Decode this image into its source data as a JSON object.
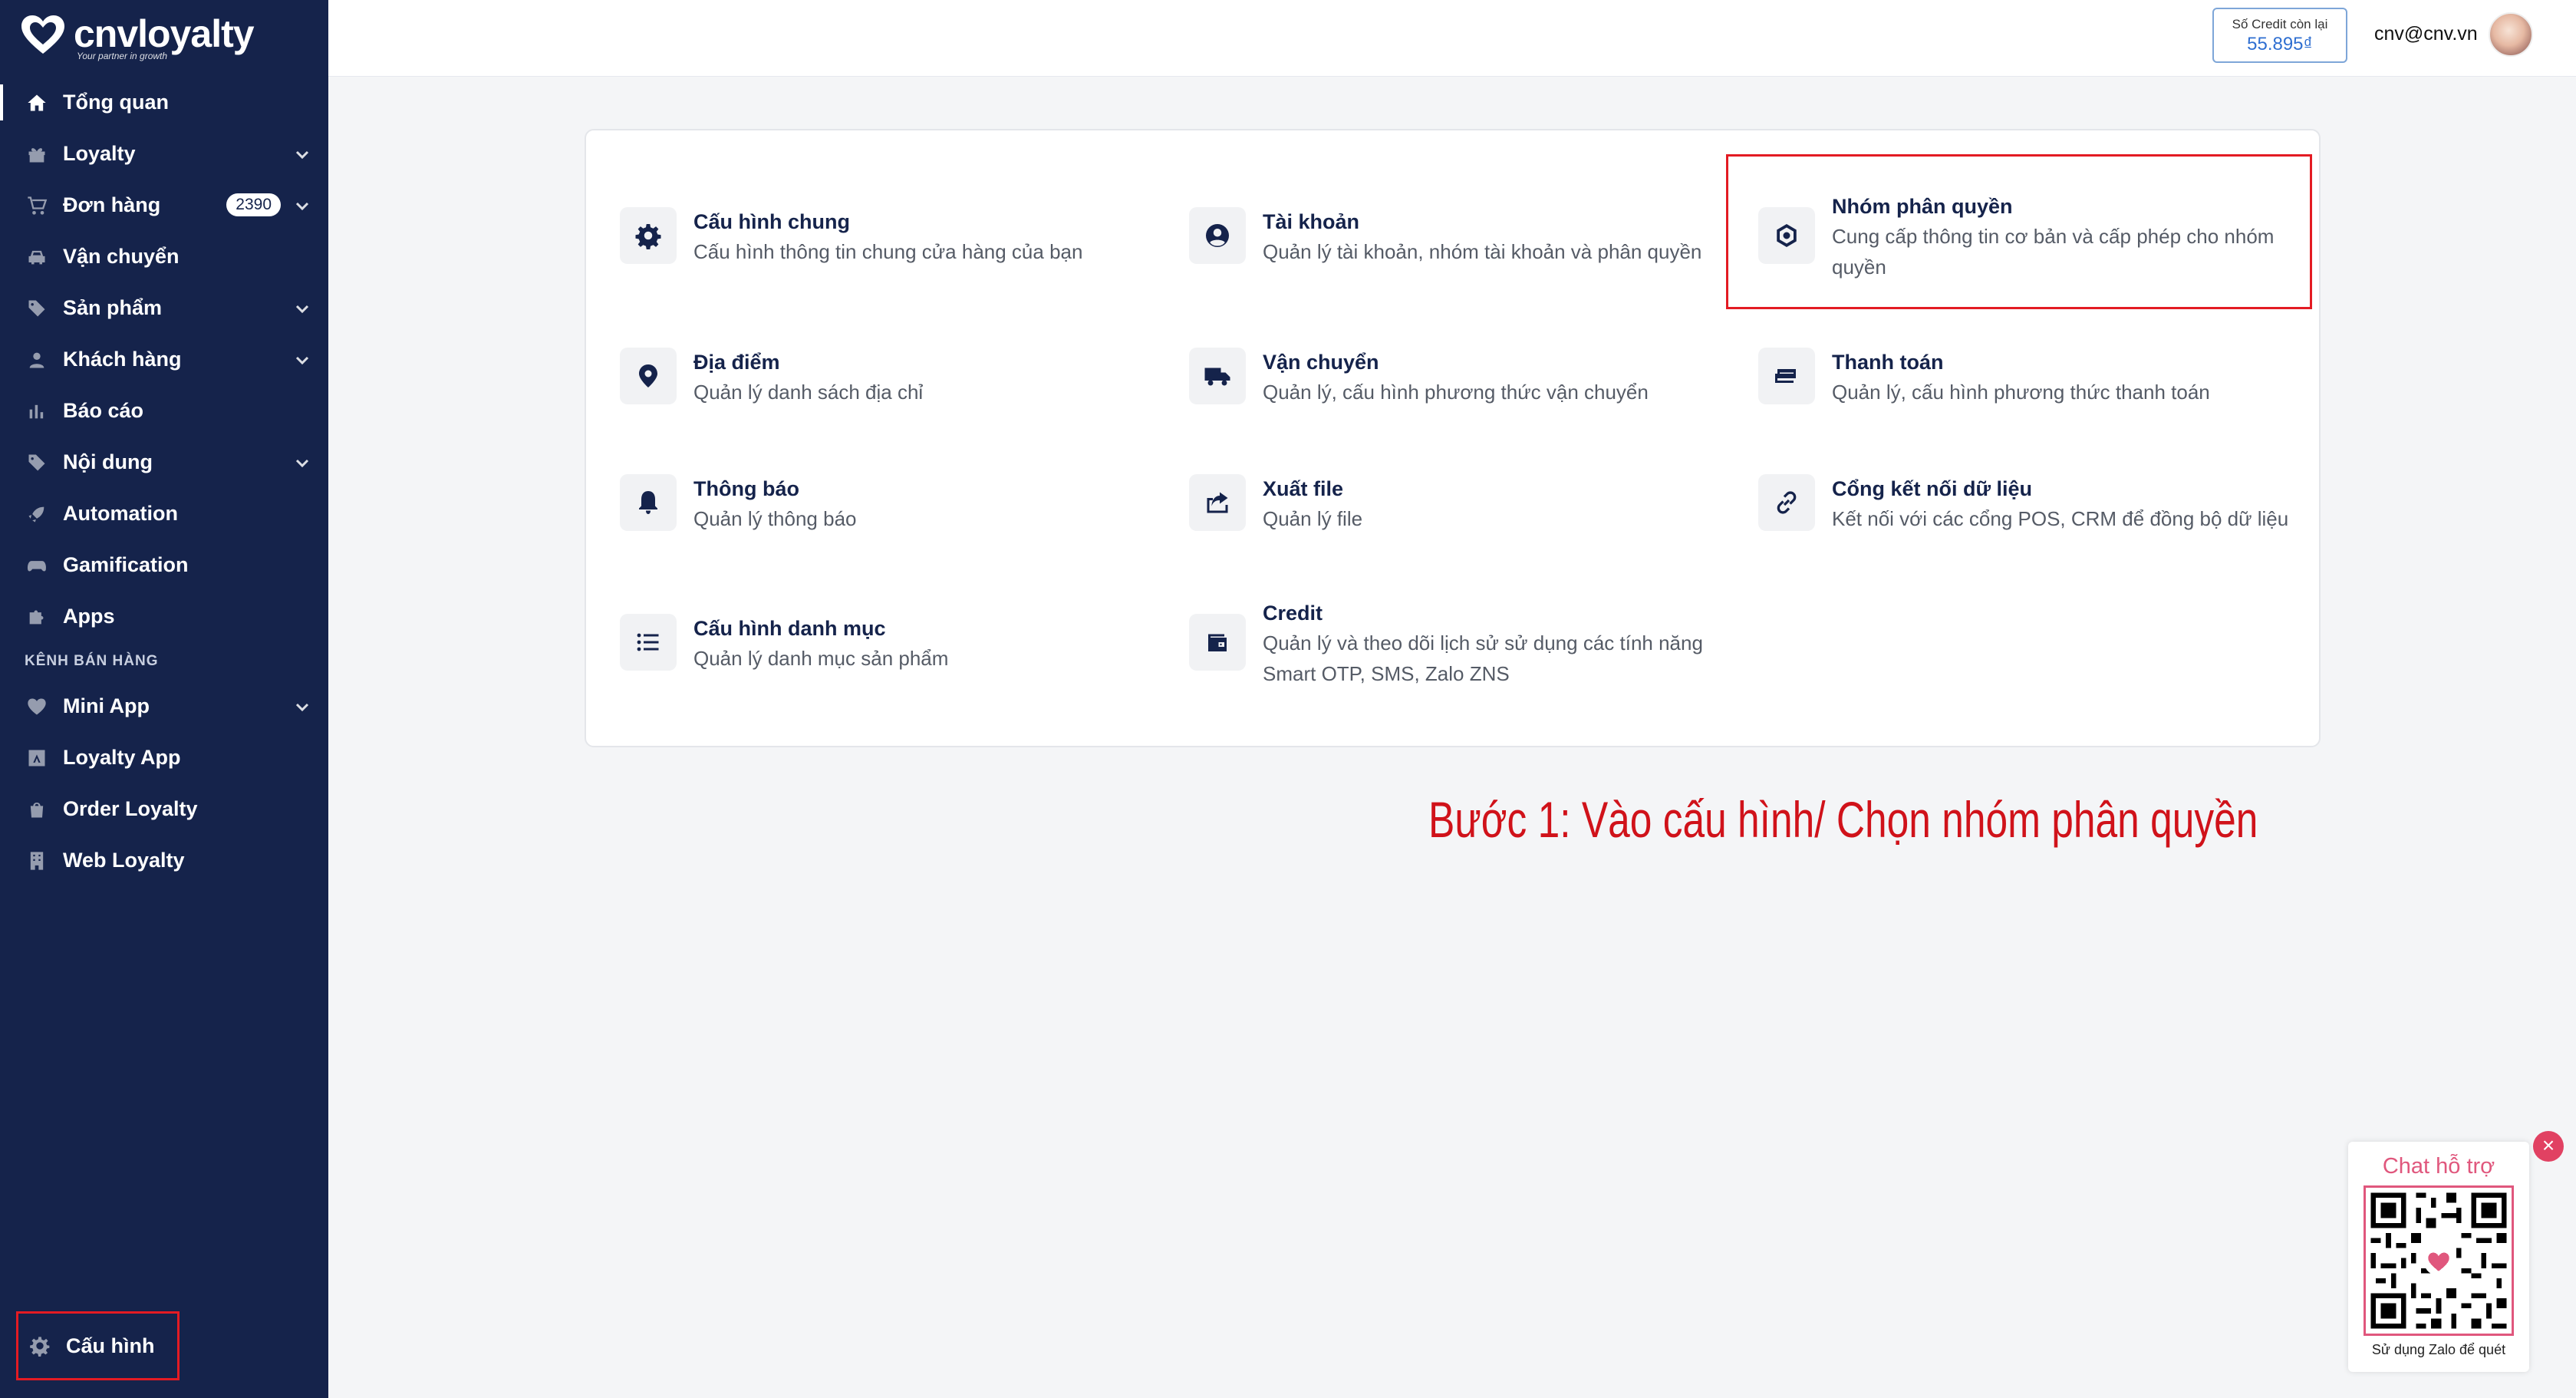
{
  "brand": {
    "name": "cnvloyalty",
    "tagline": "Your partner in growth"
  },
  "sidebar": {
    "items": [
      {
        "label": "Tổng quan",
        "icon": "home-icon",
        "active": true
      },
      {
        "label": "Loyalty",
        "icon": "gift-icon",
        "expandable": true
      },
      {
        "label": "Đơn hàng",
        "icon": "cart-icon",
        "expandable": true,
        "badge": "2390"
      },
      {
        "label": "Vận chuyển",
        "icon": "car-icon"
      },
      {
        "label": "Sản phẩm",
        "icon": "tag-icon",
        "expandable": true
      },
      {
        "label": "Khách hàng",
        "icon": "user-icon",
        "expandable": true
      },
      {
        "label": "Báo cáo",
        "icon": "bar-chart-icon"
      },
      {
        "label": "Nội dung",
        "icon": "tag-icon",
        "expandable": true
      },
      {
        "label": "Automation",
        "icon": "rocket-icon"
      },
      {
        "label": "Gamification",
        "icon": "gamepad-icon"
      },
      {
        "label": "Apps",
        "icon": "puzzle-icon"
      }
    ],
    "section_title": "KÊNH BÁN HÀNG",
    "channels": [
      {
        "label": "Mini App",
        "icon": "heart-icon",
        "expandable": true
      },
      {
        "label": "Loyalty App",
        "icon": "app-store-icon"
      },
      {
        "label": "Order Loyalty",
        "icon": "bag-icon"
      },
      {
        "label": "Web Loyalty",
        "icon": "building-icon"
      }
    ],
    "config_label": "Cấu hình"
  },
  "header": {
    "credit_label": "Số Credit còn lại",
    "credit_value": "55.895₫",
    "user_email": "cnv@cnv.vn"
  },
  "settings": {
    "general": {
      "title": "Cấu hình chung",
      "desc": "Cấu hình thông tin chung cửa hàng của bạn"
    },
    "account": {
      "title": "Tài khoản",
      "desc": "Quản lý tài khoản, nhóm tài khoản và phân quyền"
    },
    "permission_group": {
      "title": "Nhóm phân quyền",
      "desc1": "Cung cấp thông tin cơ bản và cấp phép cho nhóm",
      "desc2": "quyền"
    },
    "location": {
      "title": "Địa điểm",
      "desc": "Quản lý danh sách địa chỉ"
    },
    "shipping": {
      "title": "Vận chuyển",
      "desc": "Quản lý, cấu hình phương thức vận chuyển"
    },
    "payment": {
      "title": "Thanh toán",
      "desc": "Quản lý, cấu hình phương thức thanh toán"
    },
    "notification": {
      "title": "Thông báo",
      "desc": "Quản lý thông báo"
    },
    "export": {
      "title": "Xuất file",
      "desc": "Quản lý file"
    },
    "data_gateway": {
      "title": "Cổng kết nối dữ liệu",
      "desc": "Kết nối với các cổng POS, CRM để đồng bộ dữ liệu"
    },
    "catalog": {
      "title": "Cấu hình danh mục",
      "desc": "Quản lý danh mục sản phẩm"
    },
    "credit": {
      "title": "Credit",
      "desc1": "Quản lý và theo dõi lịch sử sử dụng các tính năng",
      "desc2": "Smart OTP, SMS, Zalo ZNS"
    }
  },
  "annotation": {
    "step_text": "Bước 1: Vào cấu hình/ Chọn nhóm phân quyền"
  },
  "chat_widget": {
    "title": "Chat hỗ trợ",
    "footer": "Sử dụng Zalo để quét",
    "close": "×"
  },
  "colors": {
    "sidebar_bg": "#15234b",
    "highlight": "#e31b23",
    "chat_accent": "#e0577d"
  }
}
